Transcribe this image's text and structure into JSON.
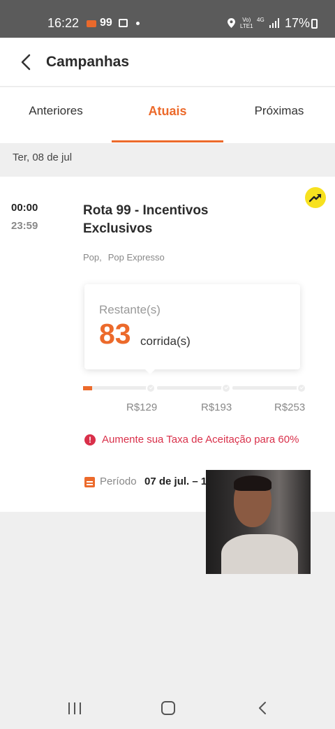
{
  "status_bar": {
    "time": "16:22",
    "app_badge": "99",
    "volte_line1": "Vo)",
    "volte_line2": "LTE1",
    "network": "4G",
    "battery": "17%"
  },
  "header": {
    "title": "Campanhas"
  },
  "tabs": [
    {
      "label": "Anteriores",
      "active": false
    },
    {
      "label": "Atuais",
      "active": true
    },
    {
      "label": "Próximas",
      "active": false
    }
  ],
  "date_label": "Ter, 08 de jul",
  "campaign": {
    "start_time": "00:00",
    "end_time": "23:59",
    "title": "Rota 99 - Incentivos Exclusivos",
    "tags": [
      "Pop,",
      "Pop Expresso"
    ],
    "remaining_label": "Restante(s)",
    "remaining_count": "83",
    "remaining_unit": "corrida(s)",
    "progress_fraction": 0.04,
    "rewards": [
      "R$129",
      "R$193",
      "R$253"
    ],
    "warning": "Aumente sua Taxa de Aceitação para 60%",
    "period_label": "Período",
    "period_value": "07 de jul. – 1"
  },
  "colors": {
    "accent": "#ec6a2b",
    "warning": "#d9304a",
    "badge": "#f7e11f"
  },
  "icons": [
    "back-arrow-icon",
    "trend-up-icon",
    "alert-icon",
    "calendar-icon",
    "recent-apps-icon",
    "home-icon",
    "nav-back-icon"
  ]
}
